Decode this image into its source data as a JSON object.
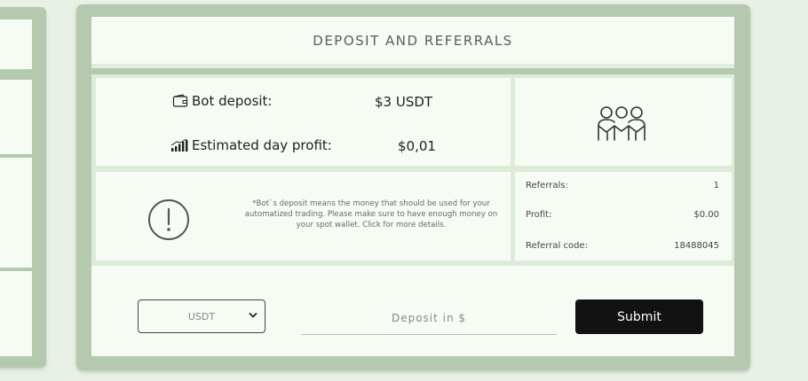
{
  "card": {
    "title": "DEPOSIT AND REFERRALS"
  },
  "deposit": {
    "bot_deposit_label": "Bot deposit:",
    "bot_deposit_value": "$3 USDT",
    "est_profit_label": "Estimated day profit:",
    "est_profit_value": "$0,01",
    "deposit_icon": "wallet-icon",
    "profit_icon": "bar-chart-icon"
  },
  "notice": {
    "icon": "alert-circle-icon",
    "text": "*Bot`s deposit means the money that should be used for your automatized trading. Please make sure to have enough money on your spot wallet. Click for more details."
  },
  "referrals": {
    "icon": "people-icon",
    "rows": [
      {
        "label": "Referrals:",
        "value": "1"
      },
      {
        "label": "Profit:",
        "value": "$0.00"
      },
      {
        "label": "Referral code:",
        "value": "18488045"
      }
    ]
  },
  "form": {
    "currency_selected": "USDT",
    "deposit_placeholder": "Deposit in $",
    "submit_label": "Submit"
  },
  "colors": {
    "card_border": "#b4c9ae",
    "cell_bg": "#f6fbf4",
    "page_bg": "#e9f1e6",
    "button_bg": "#121212"
  }
}
